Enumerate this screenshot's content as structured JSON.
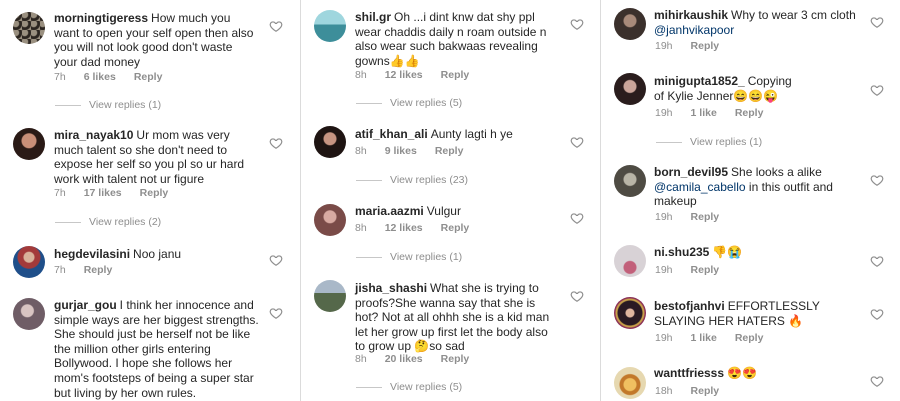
{
  "columns": [
    {
      "comments": [
        {
          "user": "morningtigeress",
          "text": "How much you want to open your self open then also you will not look good don't waste your dad money",
          "time": "7h",
          "likes": "6 likes",
          "reply": "Reply",
          "view_replies": "View replies (1)",
          "avatar_color": "#6b6256"
        },
        {
          "user": "mira_nayak10",
          "text": "Ur mom was very much talent so she don't need to expose her self so you pl so ur hard work with talent not ur figure",
          "time": "7h",
          "likes": "17 likes",
          "reply": "Reply",
          "view_replies": "View replies (2)",
          "avatar_color": "#7a4a3e"
        },
        {
          "user": "hegdevilasini",
          "text": "Noo janu",
          "time": "7h",
          "likes": "",
          "reply": "Reply",
          "view_replies": "",
          "avatar_color": "#a33a3a"
        },
        {
          "user": "gurjar_gou",
          "text": "I think her innocence and simple ways are her biggest strengths. She should just be herself not be like the million other girls entering Bollywood. I hope she follows her mom's footsteps of being a super star but living by her own rules.",
          "time": "",
          "likes": "",
          "reply": "",
          "view_replies": "",
          "avatar_color": "#8b7d86"
        }
      ]
    },
    {
      "comments": [
        {
          "user": "shil.gr",
          "text": "Oh ...i dint knw dat shy ppl wear chaddis daily n roam outside n also wear such bakwaas revealing gowns👍👍",
          "time": "8h",
          "likes": "12 likes",
          "reply": "Reply",
          "view_replies": "View replies (5)",
          "avatar_color": "#4aa3b0"
        },
        {
          "user": "atif_khan_ali",
          "text": "Aunty lagti h ye",
          "time": "8h",
          "likes": "9 likes",
          "reply": "Reply",
          "view_replies": "View replies (23)",
          "avatar_color": "#4a2f2a"
        },
        {
          "user": "maria.aazmi",
          "text": "Vulgur",
          "time": "8h",
          "likes": "12 likes",
          "reply": "Reply",
          "view_replies": "View replies (1)",
          "avatar_color": "#9c6f6a"
        },
        {
          "user": "jisha_shashi",
          "text": "What she is trying to proofs?She wanna say that she is hot? Not at all ohhh she is a kid man let her grow up first let the body also to grow up 🤔so sad",
          "time": "8h",
          "likes": "20 likes",
          "reply": "Reply",
          "view_replies": "View replies (5)",
          "avatar_color": "#55684a"
        }
      ]
    },
    {
      "comments": [
        {
          "user": "mihirkaushik",
          "text": "Why to wear 3 cm cloth",
          "mention": "@janhvikapoor",
          "time": "19h",
          "likes": "",
          "reply": "Reply",
          "view_replies": "",
          "avatar_color": "#5b4a44"
        },
        {
          "user": "minigupta1852_",
          "text": "Copying of Kylie Jenner😄😄😜",
          "time": "19h",
          "likes": "1 like",
          "reply": "Reply",
          "view_replies": "View replies (1)",
          "avatar_color": "#3a2c2c"
        },
        {
          "user": "born_devil95",
          "text": "She looks a alike",
          "mention": "@camila_cabello",
          "text2": "in this outfit and makeup",
          "time": "19h",
          "likes": "",
          "reply": "Reply",
          "view_replies": "",
          "avatar_color": "#6d6a5e"
        },
        {
          "user": "ni.shu235",
          "text": "👎😭",
          "time": "19h",
          "likes": "",
          "reply": "Reply",
          "view_replies": "",
          "avatar_color": "#b07a8c"
        },
        {
          "user": "bestofjanhvi",
          "text": "EFFORTLESSLY SLAYING HER HATERS 🔥",
          "time": "19h",
          "likes": "1 like",
          "reply": "Reply",
          "view_replies": "",
          "avatar_color": "#8a2f57"
        },
        {
          "user": "wanttfriesss",
          "text": "😍😍",
          "time": "18h",
          "likes": "",
          "reply": "Reply",
          "view_replies": "",
          "avatar_color": "#e0a23a"
        }
      ]
    }
  ],
  "icons": {
    "heart": "heart-outline-icon"
  },
  "colors": {
    "username": "#262626",
    "meta": "#8e8e8e",
    "mention": "#003569",
    "divider": "#dbdbdb"
  }
}
